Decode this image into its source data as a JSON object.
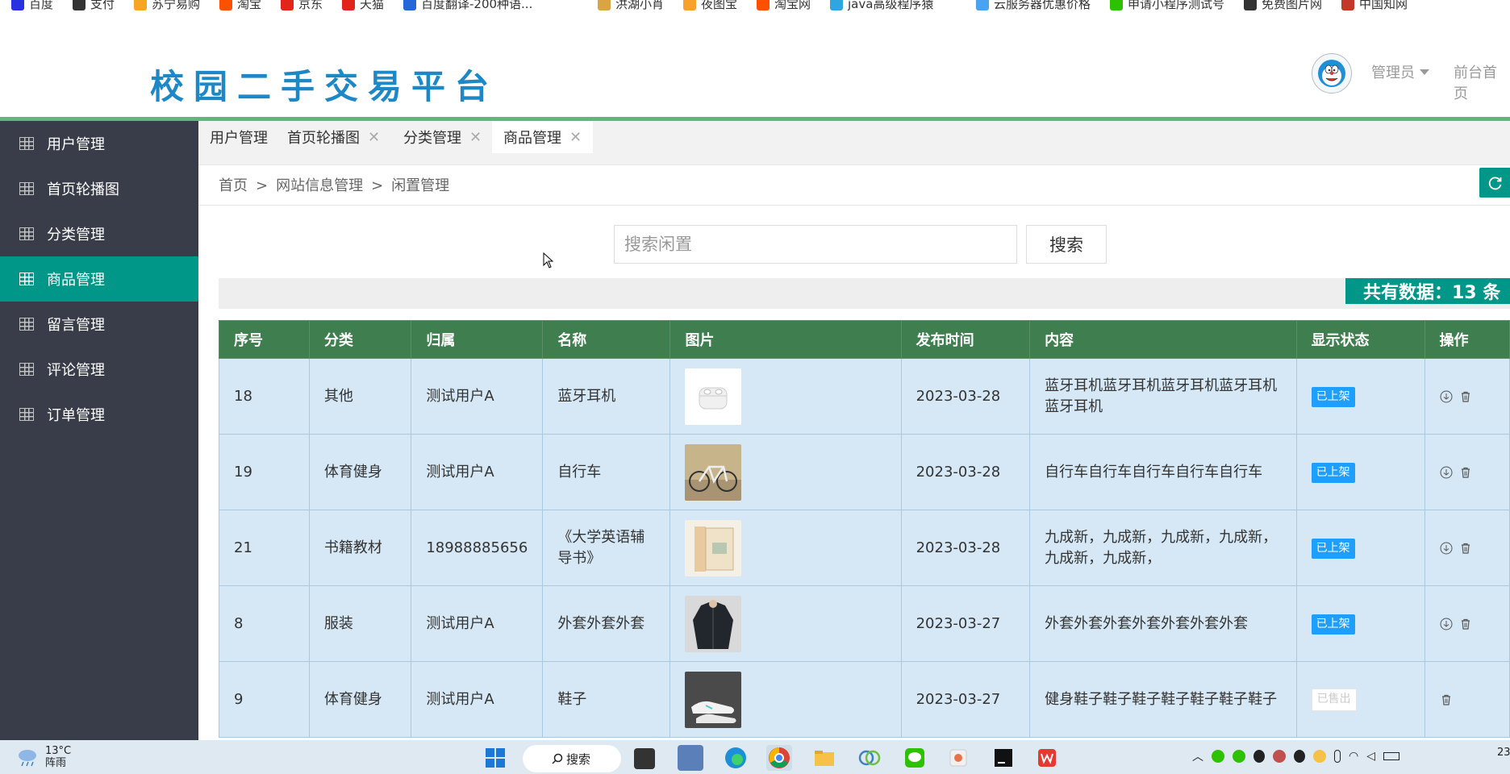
{
  "bookmarks": [
    "百度",
    "支付",
    "苏宁易购",
    "淘宝",
    "京东",
    "天猫",
    "百度翻译-200种语...",
    "洪湖小肖",
    "夜图宝",
    "淘宝网",
    "java高级程序猿",
    "云服务器优惠价格",
    "申请小程序测试号",
    "免费图片网",
    "中国知网"
  ],
  "header": {
    "logo": "校园二手交易平台",
    "admin_label": "管理员",
    "front_label": "前台首页"
  },
  "sidebar": {
    "items": [
      {
        "label": "用户管理"
      },
      {
        "label": "首页轮播图"
      },
      {
        "label": "分类管理"
      },
      {
        "label": "商品管理"
      },
      {
        "label": "留言管理"
      },
      {
        "label": "评论管理"
      },
      {
        "label": "订单管理"
      }
    ],
    "active_index": 3
  },
  "tabs": [
    {
      "label": "用户管理",
      "closable": false
    },
    {
      "label": "首页轮播图",
      "closable": true
    },
    {
      "label": "分类管理",
      "closable": true
    },
    {
      "label": "商品管理",
      "closable": true,
      "active": true
    }
  ],
  "breadcrumb": [
    "首页",
    "网站信息管理",
    "闲置管理"
  ],
  "breadcrumb_sep": ">",
  "search": {
    "placeholder": "搜索闲置",
    "value": "",
    "button": "搜索"
  },
  "total_label": "共有数据：13 条",
  "table": {
    "columns": [
      "序号",
      "分类",
      "归属",
      "名称",
      "图片",
      "发布时间",
      "内容",
      "显示状态",
      "操作"
    ],
    "rows": [
      {
        "id": "18",
        "category": "其他",
        "owner": "测试用户A",
        "name": "蓝牙耳机",
        "image": "earbuds",
        "date": "2023-03-28",
        "content": "蓝牙耳机蓝牙耳机蓝牙耳机蓝牙耳机蓝牙耳机",
        "status": "已上架"
      },
      {
        "id": "19",
        "category": "体育健身",
        "owner": "测试用户A",
        "name": "自行车",
        "image": "bicycle",
        "date": "2023-03-28",
        "content": "自行车自行车自行车自行车自行车",
        "status": "已上架"
      },
      {
        "id": "21",
        "category": "书籍教材",
        "owner": "18988885656",
        "name": "《大学英语辅导书》",
        "image": "book",
        "date": "2023-03-28",
        "content": "九成新，九成新，九成新，九成新，九成新，九成新，",
        "status": "已上架"
      },
      {
        "id": "8",
        "category": "服装",
        "owner": "测试用户A",
        "name": "外套外套外套",
        "image": "jacket",
        "date": "2023-03-27",
        "content": "外套外套外套外套外套外套外套",
        "status": "已上架"
      },
      {
        "id": "9",
        "category": "体育健身",
        "owner": "测试用户A",
        "name": "鞋子",
        "image": "sneakers",
        "date": "2023-03-27",
        "content": "健身鞋子鞋子鞋子鞋子鞋子鞋子鞋子",
        "status": "已售出"
      }
    ]
  },
  "taskbar": {
    "temperature": "13°C",
    "weather": "阵雨",
    "search_label": "搜索",
    "clock": "23"
  },
  "colors": {
    "accent": "#009688",
    "sidebar_bg": "#393d49",
    "table_header": "#3f7f4f",
    "row_bg": "#d6e8f5",
    "badge": "#1e9fff",
    "logo": "#1e88c7"
  }
}
